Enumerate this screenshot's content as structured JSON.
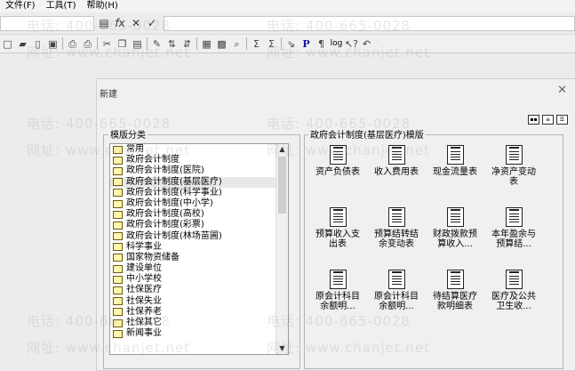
{
  "menu": [
    "文件(F)",
    "工具(T)",
    "帮助(H)"
  ],
  "toolbar": {
    "log_label": "log",
    "p_label": "P"
  },
  "watermark": {
    "phone": "电话: 400-665-0028",
    "site": "网址: www.chanjet.net"
  },
  "dialog": {
    "title": "新建",
    "category_label": "模版分类",
    "template_label": "政府会计制度(基层医疗)模版",
    "categories": [
      "常用",
      "政府会计制度",
      "政府会计制度(医院)",
      "政府会计制度(基层医疗)",
      "政府会计制度(科学事业)",
      "政府会计制度(中小学)",
      "政府会计制度(高校)",
      "政府会计制度(彩票)",
      "政府会计制度(林场苗圃)",
      "科学事业",
      "国家物资储备",
      "建设单位",
      "中小学校",
      "社保医疗",
      "社保失业",
      "社保养老",
      "社保其它",
      "新闻事业"
    ],
    "selected_category": "政府会计制度(基层医疗)",
    "templates": [
      [
        "资产负债表",
        ""
      ],
      [
        "收入费用表",
        ""
      ],
      [
        "现金流量表",
        ""
      ],
      [
        "净资产变动",
        "表"
      ],
      [
        "预算收入支",
        "出表"
      ],
      [
        "预算结转结",
        "余变动表"
      ],
      [
        "财政拨款预",
        "算收入..."
      ],
      [
        "本年盈余与",
        "预算结..."
      ],
      [
        "原会计科目",
        "余额明..."
      ],
      [
        "原会计科目",
        "余额明..."
      ],
      [
        "待结算医疗",
        "款明细表"
      ],
      [
        "医疗及公共",
        "卫生收..."
      ]
    ]
  }
}
